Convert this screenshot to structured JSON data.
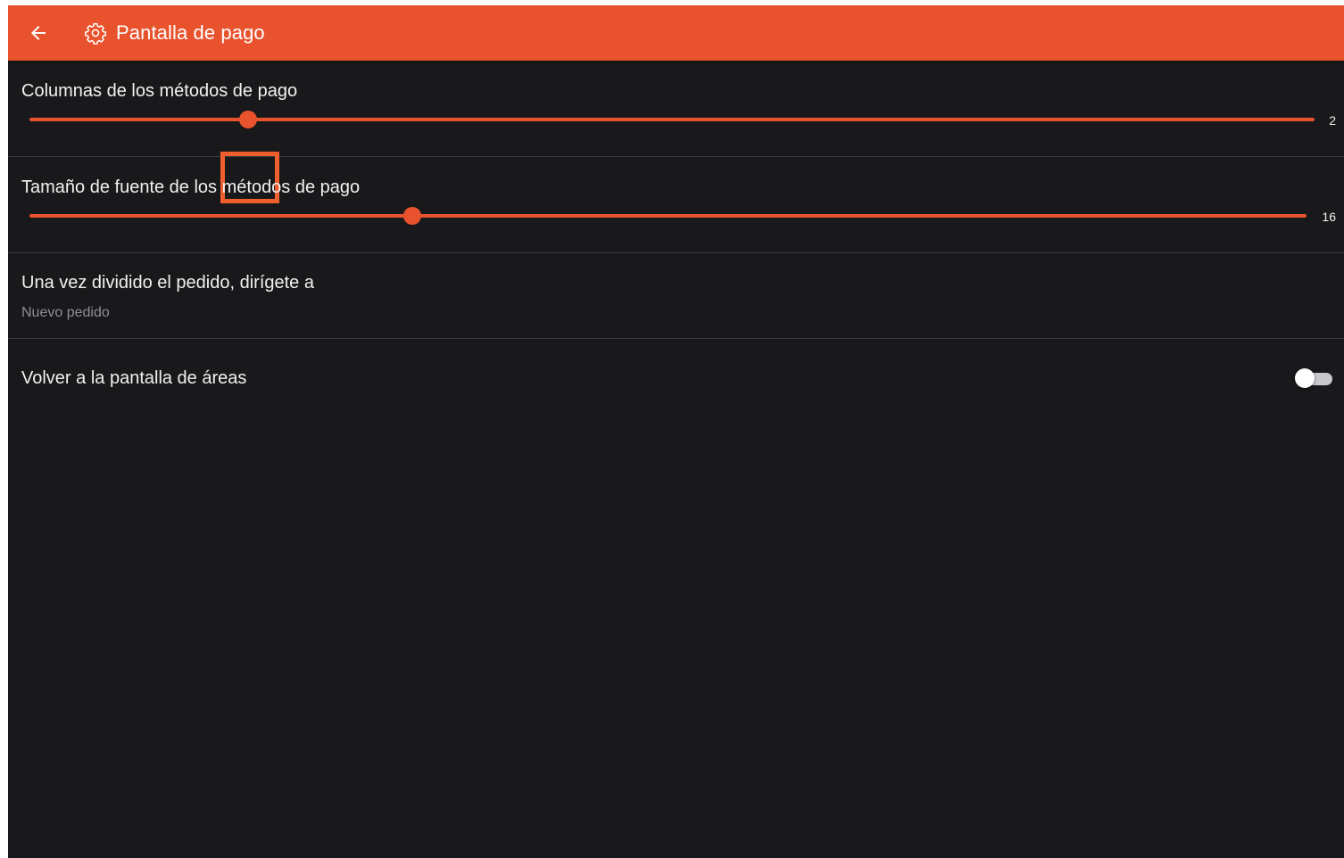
{
  "appbar": {
    "title": "Pantalla de pago",
    "back_icon": "arrow-left-icon",
    "settings_icon": "gear-icon",
    "color": "#e8532e"
  },
  "settings": {
    "columns": {
      "label": "Columnas de los métodos de pago",
      "value_text": "2",
      "position_fraction": 0.17
    },
    "font_size": {
      "label": "Tamaño de fuente de los métodos de pago",
      "value_text": "16",
      "position_fraction": 0.3
    },
    "after_split": {
      "label": "Una vez dividido el pedido, dirígete a",
      "value": "Nuevo pedido"
    },
    "return_to_areas": {
      "label": "Volver a la pantalla de áreas",
      "enabled": false
    }
  },
  "colors": {
    "accent": "#e8532e",
    "background": "#19191b",
    "highlight": "#ef5f2e"
  }
}
